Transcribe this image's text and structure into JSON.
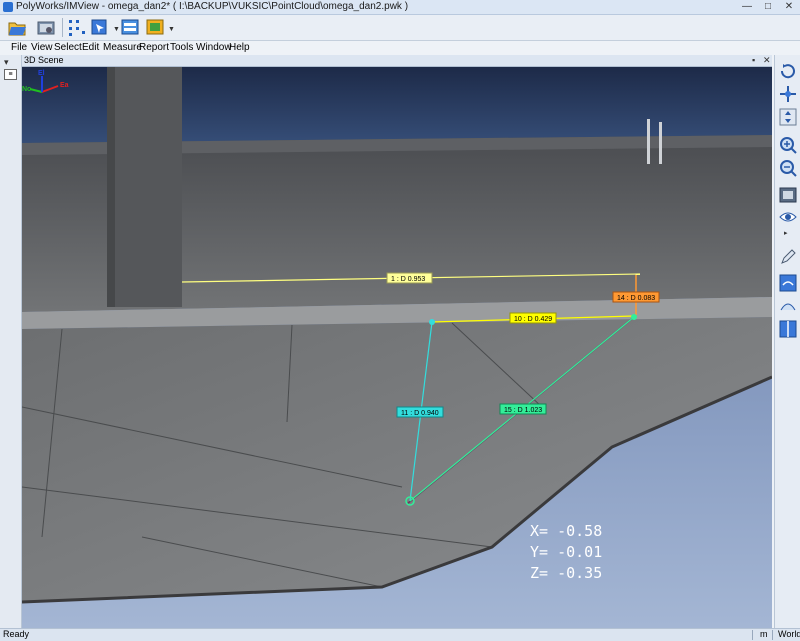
{
  "window": {
    "title": "PolyWorks/IMView - omega_dan2* ( I:\\BACKUP\\VUKSIC\\PointCloud\\omega_dan2.pwk )",
    "controls": [
      "—",
      "□",
      "✕"
    ]
  },
  "menu": [
    "File",
    "View",
    "Select",
    "Edit",
    "Measure",
    "Report",
    "Tools",
    "Window",
    "Help"
  ],
  "scene": {
    "panel_title": "3D Scene",
    "pin_glyph": "▪",
    "close_glyph": "✕"
  },
  "axes_triad": {
    "labels": [
      "Ea",
      "No",
      "El"
    ],
    "colors": {
      "east": "#e02020",
      "north": "#20c020",
      "elevation": "#2040e0"
    }
  },
  "measurements": [
    {
      "id": "1",
      "label": "1 : D 0.953",
      "color": "#ffff80"
    },
    {
      "id": "10",
      "label": "10 : D 0.429",
      "color": "#ffff00"
    },
    {
      "id": "14",
      "label": "14 : D 0.083",
      "color": "#ff9933"
    },
    {
      "id": "11",
      "label": "11 : D 0.940",
      "color": "#33dddd"
    },
    {
      "id": "15",
      "label": "15 : D 1.023",
      "color": "#33ee99"
    }
  ],
  "coordinates": {
    "x": "X= -0.58",
    "y": "Y= -0.01",
    "z": "Z= -0.35"
  },
  "status": {
    "text": "Ready",
    "unit": "m",
    "coordinate_system": "World"
  },
  "icons": {
    "toolbar": [
      "open-icon",
      "properties-icon",
      "select-points-icon",
      "select-dropdown-icon",
      "display-mode-icon",
      "render-mode-icon"
    ],
    "right": [
      "rotate-icon",
      "translate-icon",
      "pan-icon",
      "zoom-in-icon",
      "zoom-out-icon",
      "view-camera-icon",
      "eye-icon",
      "pencil-icon",
      "view-fit-icon",
      "align-icon",
      "split-view-icon"
    ]
  }
}
